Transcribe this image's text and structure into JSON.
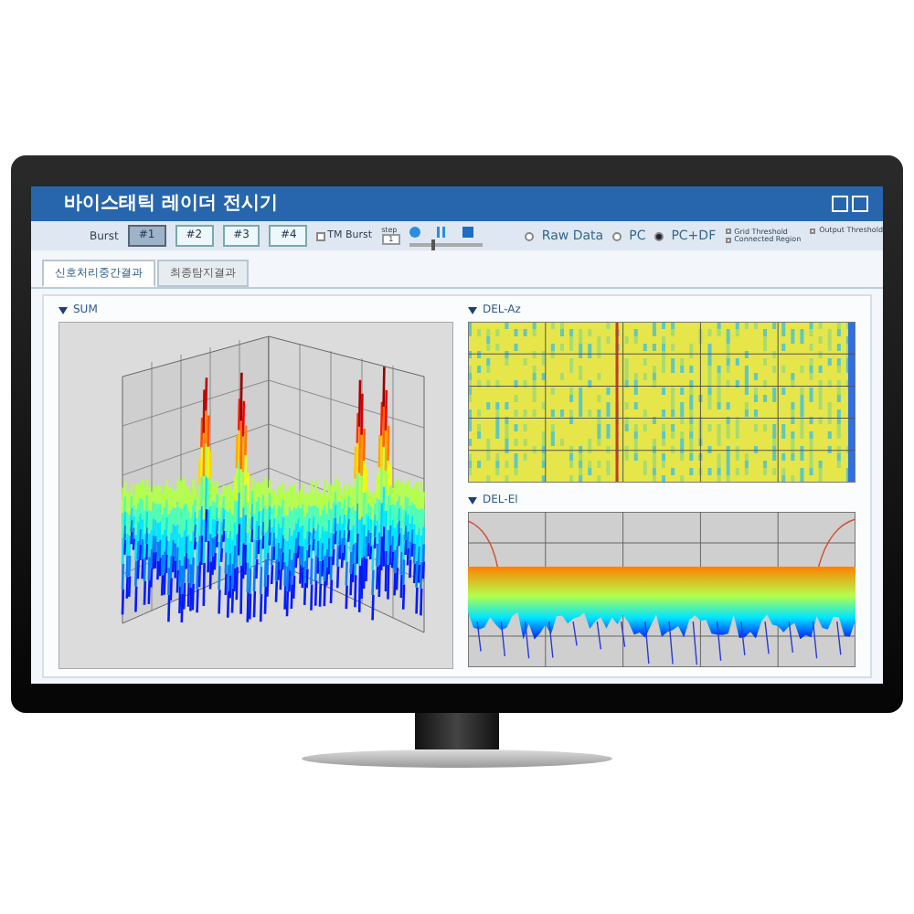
{
  "window": {
    "title": "바이스태틱 레이더 전시기"
  },
  "toolbar": {
    "burst_label": "Burst",
    "bursts": [
      {
        "label": "#1",
        "selected": true
      },
      {
        "label": "#2",
        "selected": false
      },
      {
        "label": "#3",
        "selected": false
      },
      {
        "label": "#4",
        "selected": false
      }
    ],
    "tm_option": {
      "label": "TM Burst",
      "checked": false
    },
    "step": {
      "label": "step",
      "value": "1"
    },
    "speed": {
      "level": 0.3
    },
    "modes": [
      {
        "label": "Raw Data",
        "selected": false
      },
      {
        "label": "PC",
        "selected": false
      },
      {
        "label": "PC+DF",
        "selected": true
      }
    ],
    "options": [
      {
        "label": "Grid Threshold",
        "checked": false
      },
      {
        "label": "Connected Region",
        "checked": false
      },
      {
        "label": "Output Threshold",
        "checked": false
      }
    ]
  },
  "tabs": [
    {
      "label": "신호처리중간결과",
      "selected": true
    },
    {
      "label": "최종탐지결과",
      "selected": false
    }
  ],
  "panels": [
    {
      "title": "SUM",
      "kind": "surface"
    },
    {
      "title": "DEL-Az",
      "kind": "heatmap"
    },
    {
      "title": "DEL-El",
      "kind": "lines"
    }
  ]
}
